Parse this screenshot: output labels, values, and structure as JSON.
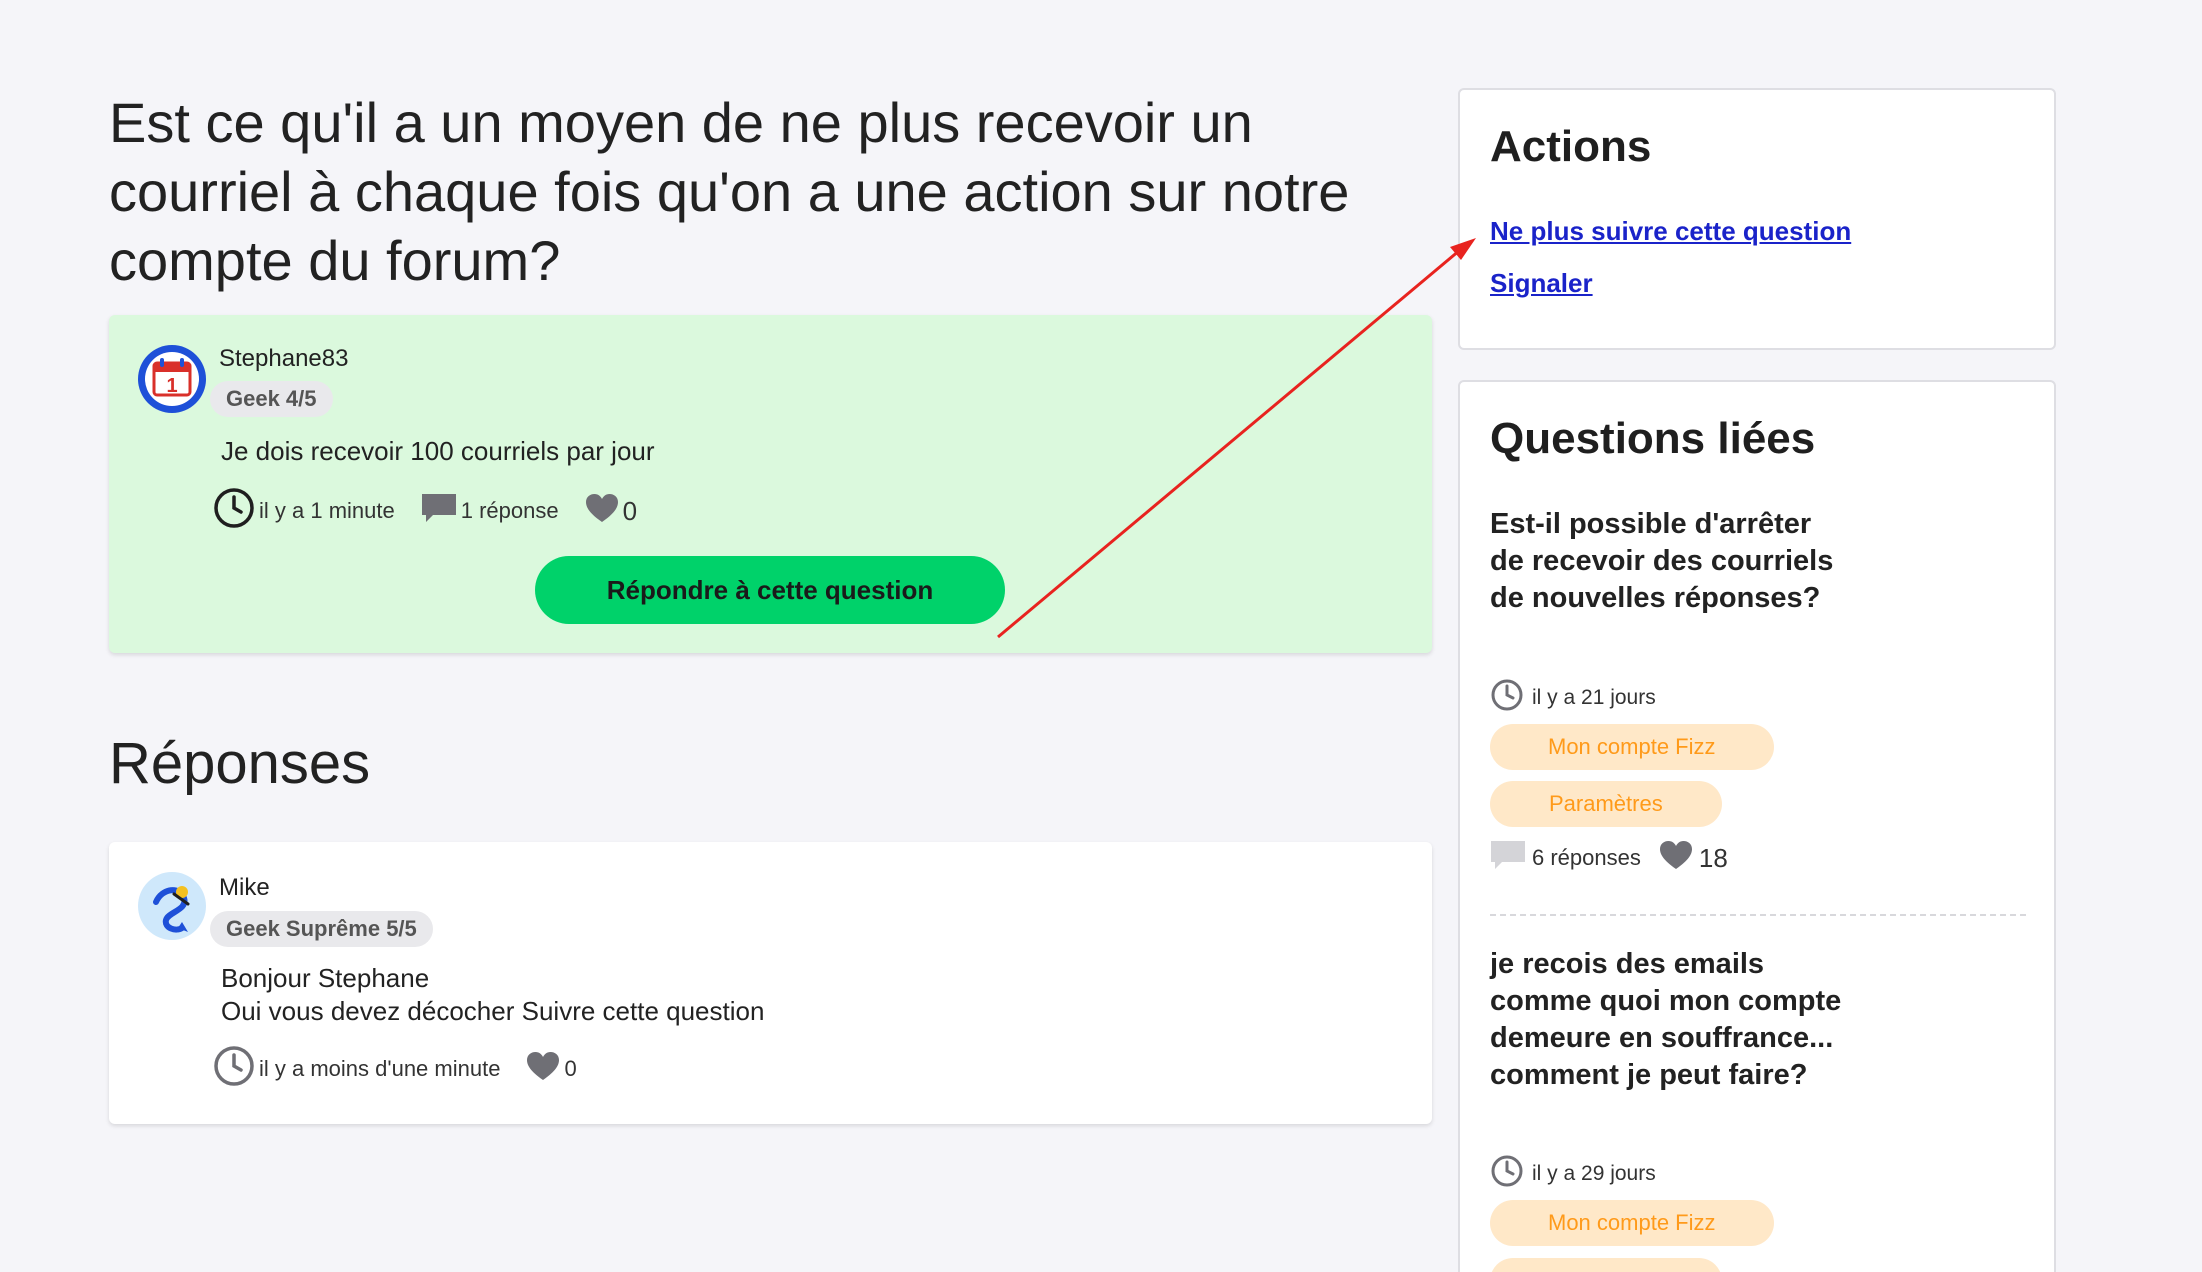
{
  "question": {
    "title": "Est ce qu'il a un moyen de ne plus recevoir un courriel à chaque fois qu'on a une action sur notre compte du forum?",
    "author": "Stephane83",
    "badge": "Geek 4/5",
    "body": "Je dois recevoir 100 courriels par jour",
    "time": "il y a 1 minute",
    "replies": "1 réponse",
    "likes": "0",
    "reply_button": "Répondre à cette question"
  },
  "answers": {
    "title": "Réponses",
    "items": [
      {
        "author": "Mike",
        "badge": "Geek Suprême 5/5",
        "body_line1": "Bonjour Stephane",
        "body_line2": "Oui vous devez décocher Suivre cette question",
        "time": "il y a moins d'une minute",
        "likes": "0"
      }
    ]
  },
  "actions": {
    "title": "Actions",
    "unfollow": "Ne plus suivre cette question",
    "report": "Signaler"
  },
  "related": {
    "title": "Questions liées",
    "items": [
      {
        "title": "Est-il possible d'arrêter de recevoir des courriels de nouvelles réponses?",
        "time": "il y a 21 jours",
        "tags": [
          "Mon compte Fizz",
          "Paramètres"
        ],
        "replies": "6 réponses",
        "likes": "18"
      },
      {
        "title": "je recois des emails comme quoi mon compte demeure en souffrance... comment je peut faire?",
        "time": "il y a 29 jours",
        "tags": [
          "Mon compte Fizz"
        ]
      }
    ]
  },
  "colors": {
    "question_bg": "#dbf9dd",
    "reply_button": "#00d26a",
    "link": "#1a23c9",
    "tag_bg": "#ffe8c8",
    "tag_text": "#ff9a1a",
    "annotation_arrow": "#e8231f"
  },
  "icons": [
    "clock-icon",
    "comment-icon",
    "heart-icon",
    "calendar-avatar-icon",
    "genie-avatar-icon"
  ]
}
